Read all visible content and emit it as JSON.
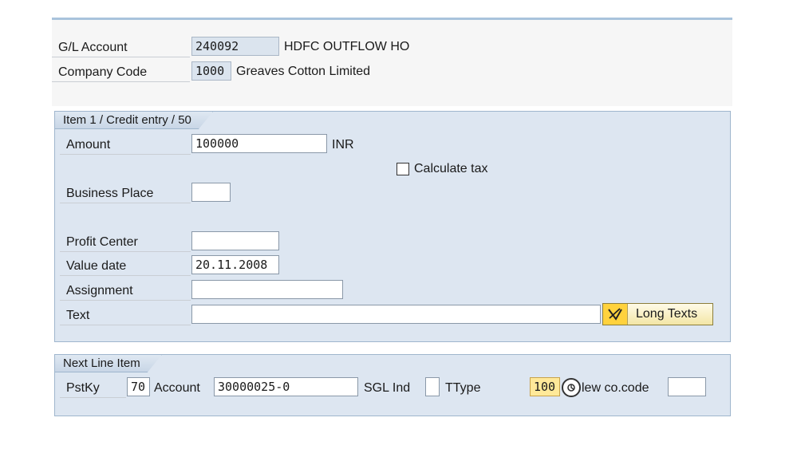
{
  "header": {
    "gl_account_label": "G/L Account",
    "gl_account_value": "240092",
    "gl_account_desc": "HDFC OUTFLOW  HO",
    "company_code_label": "Company Code",
    "company_code_value": "1000",
    "company_code_desc": "Greaves Cotton Limited"
  },
  "item": {
    "title": "Item 1 / Credit entry / 50",
    "amount_label": "Amount",
    "amount_value": "100000",
    "currency": "INR",
    "calc_tax_label": "Calculate tax",
    "business_place_label": "Business Place",
    "business_place_value": "",
    "profit_center_label": "Profit Center",
    "profit_center_value": "",
    "value_date_label": "Value date",
    "value_date_value": "20.11.2008",
    "assignment_label": "Assignment",
    "assignment_value": "",
    "text_label": "Text",
    "text_value": "",
    "long_texts_label": "Long Texts"
  },
  "next_line": {
    "title": "Next Line Item",
    "pstky_label": "PstKy",
    "pstky_value": "70",
    "account_label": "Account",
    "account_value": "30000025-0",
    "sgl_label": "SGL Ind",
    "sgl_value": "",
    "ttype_label": "TType",
    "ttype_value": "100",
    "new_cocode_label": "lew co.code",
    "new_cocode_value": ""
  },
  "icons": {
    "long_texts": "pencil-note-icon",
    "cursor": "mouse-cursor-icon"
  },
  "colors": {
    "panel_bg": "#dde6f1",
    "highlight": "#ffe999",
    "button_icon": "#ffd23d"
  }
}
